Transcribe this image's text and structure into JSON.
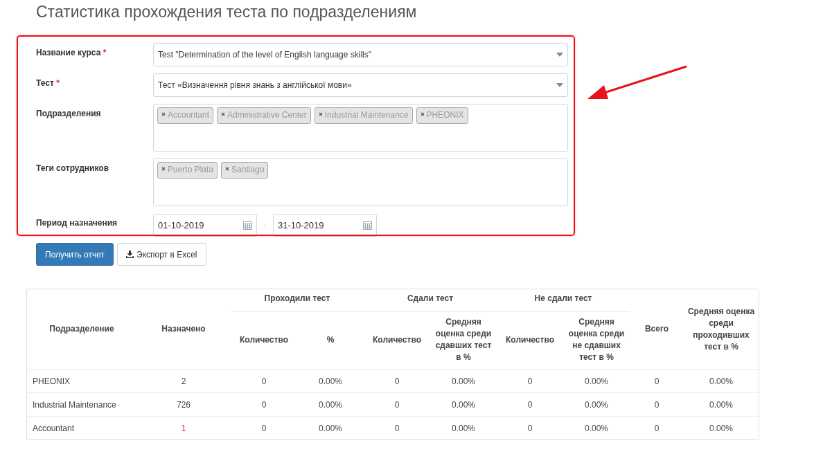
{
  "page_title": "Статистика прохождения теста по подразделениям",
  "form": {
    "fields": [
      {
        "kind": "select",
        "label": "Название курса",
        "required": true,
        "value": "Test \"Determination of the level of English language skills\""
      },
      {
        "kind": "select",
        "label": "Тест",
        "required": true,
        "value": "Тест «Визначення рівня знань з англійської мови»"
      },
      {
        "kind": "tags",
        "label": "Подразделения",
        "required": false,
        "tags": [
          "Accountant",
          "Administrative Center",
          "Industrial Maintenance",
          "PHEONIX"
        ]
      },
      {
        "kind": "tags",
        "label": "Теги сотрудников",
        "required": false,
        "tags": [
          "Puerto Plata",
          "Santiago"
        ]
      },
      {
        "kind": "daterange",
        "label": "Период назначения",
        "required": false,
        "from": "01-10-2019",
        "separator": "-",
        "to": "31-10-2019"
      }
    ],
    "required_mark": "*"
  },
  "buttons": {
    "primary": "Получить отчет",
    "export": "Экспорт в Excel"
  },
  "table": {
    "groups": [
      "Проходили тест",
      "Сдали тест",
      "Не сдали тест"
    ],
    "col_department": "Подразделение",
    "col_assigned": "Назначено",
    "subcolumns": [
      "Количество",
      "%",
      "Количество",
      "Средняя оценка среди сдавших тест в %",
      "Количество",
      "Средняя оценка среди не сдавших тест в %"
    ],
    "col_total": "Всего",
    "col_avg": "Средняя оценка среди проходивших тест в %",
    "rows": [
      {
        "department": "PHEONIX",
        "assigned": "2",
        "assigned_flagged": false,
        "cells": [
          "0",
          "0.00%",
          "0",
          "0.00%",
          "0",
          "0.00%",
          "0",
          "0.00%"
        ]
      },
      {
        "department": "Industrial Maintenance",
        "assigned": "726",
        "assigned_flagged": false,
        "cells": [
          "0",
          "0.00%",
          "0",
          "0.00%",
          "0",
          "0.00%",
          "0",
          "0.00%"
        ]
      },
      {
        "department": "Accountant",
        "assigned": "1",
        "assigned_flagged": true,
        "cells": [
          "0",
          "0.00%",
          "0",
          "0.00%",
          "0",
          "0.00%",
          "0",
          "0.00%"
        ]
      }
    ]
  }
}
